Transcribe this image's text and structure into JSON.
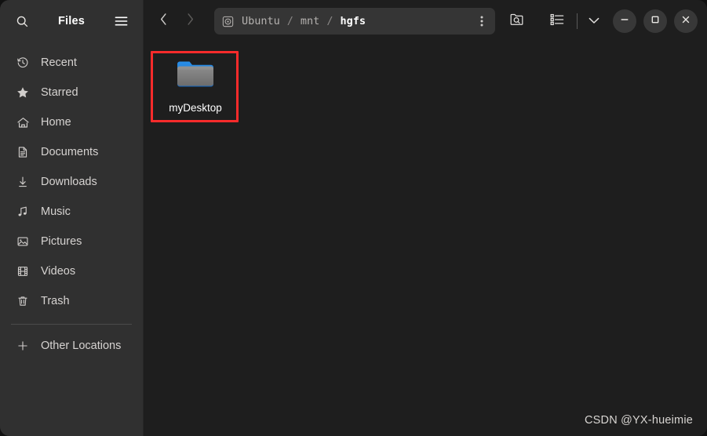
{
  "window": {
    "title": "Files",
    "bg_color": "#1e1e1e",
    "sidebar_bg_color": "#303030",
    "accent_color": "#3584e4",
    "highlight_color": "#fa2b2b"
  },
  "sidebar": {
    "title": "Files",
    "search_icon": "search-icon",
    "menu_icon": "hamburger-menu-icon",
    "items": [
      {
        "label": "Recent",
        "icon": "clock-icon"
      },
      {
        "label": "Starred",
        "icon": "star-icon"
      },
      {
        "label": "Home",
        "icon": "home-icon"
      },
      {
        "label": "Documents",
        "icon": "document-icon"
      },
      {
        "label": "Downloads",
        "icon": "download-icon"
      },
      {
        "label": "Music",
        "icon": "music-note-icon"
      },
      {
        "label": "Pictures",
        "icon": "image-icon"
      },
      {
        "label": "Videos",
        "icon": "film-icon"
      },
      {
        "label": "Trash",
        "icon": "trash-icon"
      }
    ],
    "other_locations": {
      "label": "Other Locations",
      "icon": "plus-icon"
    }
  },
  "toolbar": {
    "back_icon": "chevron-left-icon",
    "forward_icon": "chevron-right-icon",
    "pathbar": {
      "disk_icon": "disk-drive-icon",
      "crumbs": [
        {
          "label": "Ubuntu",
          "current": false
        },
        {
          "label": "mnt",
          "current": false
        },
        {
          "label": "hgfs",
          "current": true
        }
      ],
      "separator": "/",
      "menu_icon": "kebab-menu-icon"
    },
    "search_folder_icon": "folder-search-icon",
    "view_list_icon": "list-view-icon",
    "view_dropdown_icon": "chevron-down-icon",
    "minimize_label": "–",
    "maximize_label": "□",
    "close_label": "✕"
  },
  "content": {
    "files": [
      {
        "name": "myDesktop",
        "type": "folder",
        "highlighted": true
      }
    ]
  },
  "watermark": {
    "text": "CSDN @YX-hueimie"
  }
}
